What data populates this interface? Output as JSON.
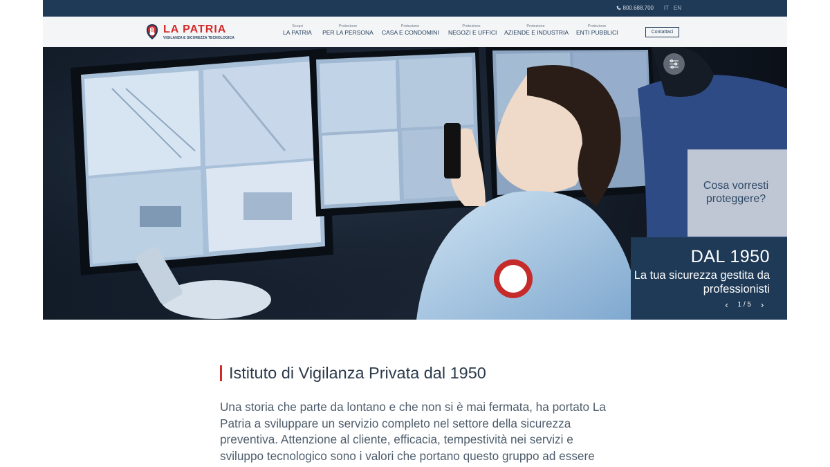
{
  "topbar": {
    "phone": "800.688.700",
    "lang_it": "IT",
    "lang_en": "EN"
  },
  "logo": {
    "name": "LA PATRIA",
    "tagline": "VIGILANZA E SICUREZZA TECNOLOGICA"
  },
  "nav": [
    {
      "small": "Scopri",
      "big": "LA PATRIA"
    },
    {
      "small": "Protezione",
      "big": "PER LA PERSONA"
    },
    {
      "small": "Protezione",
      "big": "CASA E CONDOMINI"
    },
    {
      "small": "Protezione",
      "big": "NEGOZI E UFFICI"
    },
    {
      "small": "Protezione",
      "big": "AZIENDE E INDUSTRIA"
    },
    {
      "small": "Protezione",
      "big": "ENTI PUBBLICI"
    }
  ],
  "contact_label": "Contattaci",
  "hero": {
    "question": "Cosa vorresti proteggere?",
    "year": "DAL 1950",
    "subtitle": "La tua sicurezza gestita da professionisti",
    "pager": "1 / 5"
  },
  "intro": {
    "title": "Istituto di Vigilanza Privata dal 1950",
    "body": "Una storia che parte da lontano e che non si è mai fermata, ha portato La Patria a sviluppare un servizio completo nel settore della sicurezza preventiva. Attenzione al cliente, efficacia, tempestività nei servizi e sviluppo tecnologico sono i valori che portano questo gruppo ad essere un partner affidabile nella"
  },
  "colors": {
    "navy": "#1f3a57",
    "brand_red": "#d42a2a",
    "header_bg": "#f4f5f7"
  }
}
